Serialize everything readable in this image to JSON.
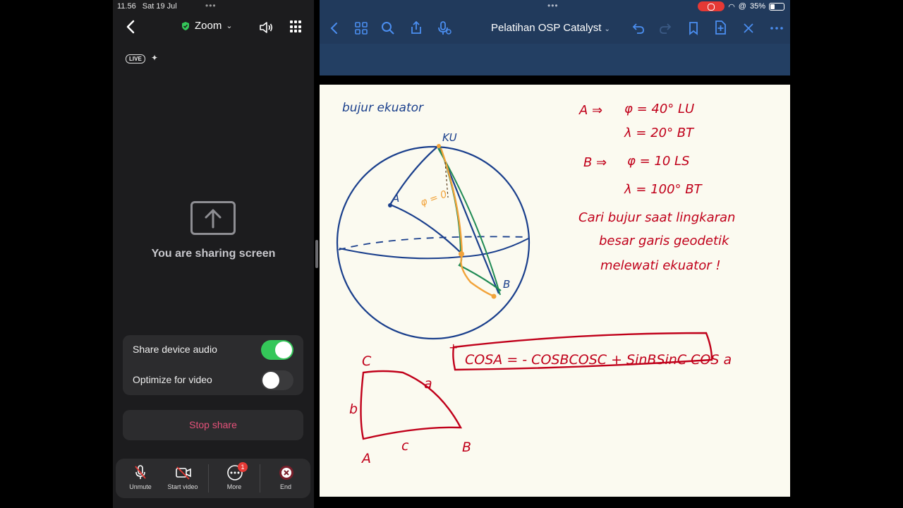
{
  "zoom": {
    "status": {
      "time": "11.56",
      "date": "Sat 19 Jul"
    },
    "title": "Zoom",
    "live_label": "LIVE",
    "sharing_message": "You are sharing screen",
    "options": [
      {
        "label": "Share device audio",
        "enabled": true
      },
      {
        "label": "Optimize for video",
        "enabled": false
      }
    ],
    "stop_share_label": "Stop share",
    "toolbar": {
      "unmute": "Unmute",
      "start_video": "Start video",
      "more": "More",
      "more_badge": "1",
      "end": "End"
    },
    "colors": {
      "accent_green": "#34c759",
      "stop_share": "#e5527a",
      "end_red": "#e53935"
    }
  },
  "notes": {
    "document_title": "Pelatihan OSP Catalyst",
    "battery": "35%",
    "pen_colors": [
      "#1a9a5a",
      "#f2a33a",
      "#d9001b",
      "#1e5aa8"
    ],
    "page": {
      "heading": "bujur ekuator",
      "given": [
        {
          "label": "A",
          "lines": [
            "φ = 40° LU",
            "λ = 20° BT"
          ]
        },
        {
          "label": "B",
          "lines": [
            "φ = 10 LS",
            "λ = 100° BT"
          ]
        }
      ],
      "question": [
        "Cari bujur saat lingkaran",
        "besar garis geodetik",
        "melewati ekuator !"
      ],
      "formula": "COSA = - COSBCOSC + SinBSinC COS a",
      "sphere_labels": {
        "pole": "KU",
        "point_a": "A",
        "point_b": "B",
        "phi0": "φ = 0"
      },
      "triangle_labels": {
        "vertex_c": "C",
        "vertex_a": "A",
        "vertex_b": "B",
        "side_a": "a",
        "side_b": "b",
        "side_c": "c"
      },
      "ink_colors": {
        "blue": "#1a3f8c",
        "red": "#c0001a",
        "orange": "#f2a33a",
        "green": "#1f8a54"
      }
    }
  }
}
